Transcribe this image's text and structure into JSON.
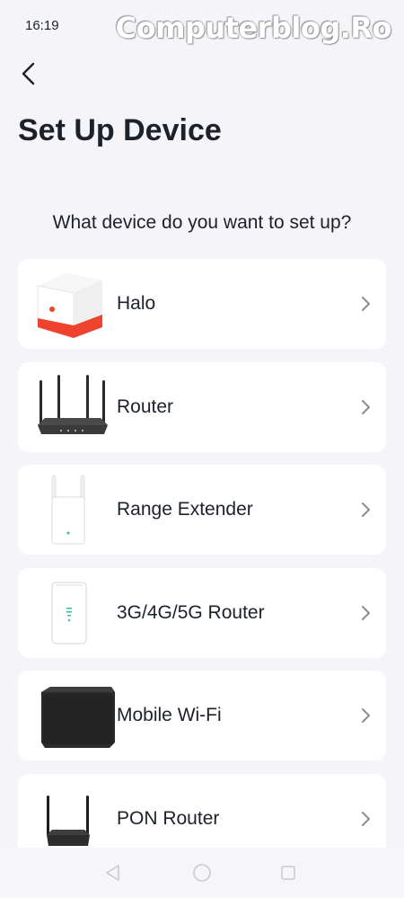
{
  "status_bar": {
    "time": "16:19"
  },
  "watermark": "Computerblog.Ro",
  "header": {
    "back_icon": "chevron-left-icon",
    "title": "Set Up Device"
  },
  "question": "What device do you want to set up?",
  "devices": [
    {
      "label": "Halo",
      "icon": "halo-mesh-device-icon"
    },
    {
      "label": "Router",
      "icon": "router-device-icon"
    },
    {
      "label": "Range Extender",
      "icon": "range-extender-device-icon"
    },
    {
      "label": "3G/4G/5G Router",
      "icon": "mobile-router-device-icon"
    },
    {
      "label": "Mobile Wi-Fi",
      "icon": "mobile-wifi-device-icon"
    },
    {
      "label": "PON Router",
      "icon": "pon-router-device-icon"
    }
  ],
  "nav_bar": {
    "icons": [
      "back-triangle-icon",
      "home-circle-icon",
      "recents-square-icon"
    ]
  },
  "colors": {
    "background": "#f4f4f9",
    "card": "#ffffff",
    "halo_accent": "#f0432f",
    "extender_led": "#2fbfa0"
  }
}
